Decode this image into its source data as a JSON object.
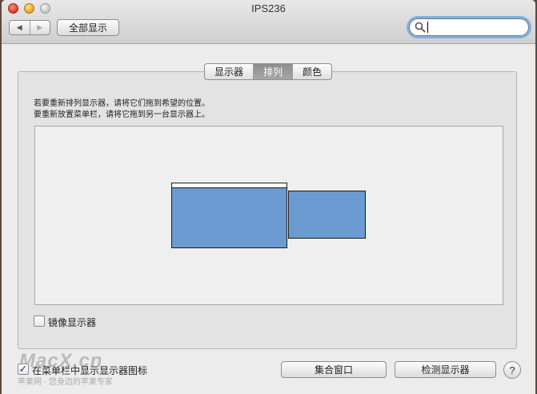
{
  "window": {
    "title": "IPS236"
  },
  "toolbar": {
    "back_label": "◀",
    "forward_label": "▶",
    "show_all_label": "全部显示",
    "search_value": "",
    "search_placeholder": ""
  },
  "tabs": [
    {
      "label": "显示器",
      "active": false
    },
    {
      "label": "排列",
      "active": true
    },
    {
      "label": "颜色",
      "active": false
    }
  ],
  "instructions": {
    "line1": "若要重新排列显示器，请将它们拖到希望的位置。",
    "line2": "要重新放置菜单栏，请将它拖到另一台显示器上。"
  },
  "mirror": {
    "label": "镜像显示器",
    "checked": false
  },
  "show_in_menubar": {
    "label": "在菜单栏中显示显示器图标",
    "checked": true,
    "check_glyph": "✓"
  },
  "buttons": {
    "gather_label": "集合窗口",
    "detect_label": "检测显示器",
    "help_label": "?"
  },
  "watermark": {
    "brand": "MacX.cn",
    "slogan": "苹果网 - 您身边的苹果专家"
  },
  "colors": {
    "display_fill": "#6a9bd1",
    "accent_focus": "#7fb0e4"
  }
}
